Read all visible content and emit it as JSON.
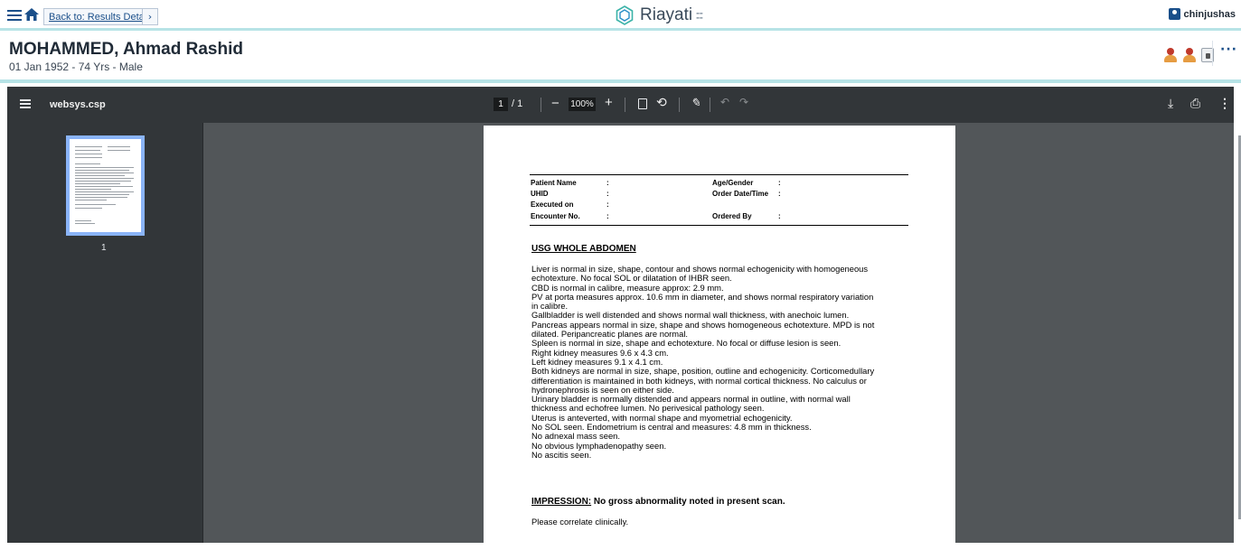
{
  "topbar": {
    "back_label": "Back to: Results Detail",
    "brand": "Riayati",
    "user": "chinjushas"
  },
  "patient": {
    "name": "MOHAMMED, Ahmad Rashid",
    "details": "01 Jan 1952 - 74 Yrs - Male"
  },
  "viewer": {
    "file_name": "websys.csp",
    "current_page": "1",
    "total_pages": "/ 1",
    "zoom": "100%",
    "thumbnail_label": "1"
  },
  "report": {
    "header_rows": [
      {
        "l1": "Patient Name",
        "l2": ":",
        "r1": "Age/Gender",
        "r2": ":"
      },
      {
        "l1": "UHID",
        "l2": ":",
        "r1": "Order Date/Time",
        "r2": ":"
      },
      {
        "l1": "Executed on",
        "l2": ":",
        "r1": "",
        "r2": ""
      },
      {
        "l1": "Encounter No.",
        "l2": ":",
        "r1": "Ordered By",
        "r2": ":"
      }
    ],
    "title": "USG WHOLE ABDOMEN",
    "lines": [
      "Liver is normal in size, shape, contour and shows normal echogenicity with homogeneous",
      "echotexture. No focal SOL or dilatation of IHBR seen.",
      "CBD is normal in calibre, measure approx: 2.9 mm.",
      "PV at porta measures approx. 10.6 mm in diameter, and shows normal respiratory variation",
      "in calibre.",
      "Gallbladder is well distended and shows normal wall thickness, with anechoic lumen.",
      "Pancreas appears normal in size, shape and shows homogeneous echotexture. MPD is not",
      "dilated. Peripancreatic planes are normal.",
      "Spleen is normal in size, shape and echotexture. No focal or diffuse lesion is seen.",
      "Right kidney measures 9.6 x 4.3 cm.",
      "Left kidney measures 9.1 x 4.1 cm.",
      "Both kidneys are normal in size, shape, position, outline and echogenicity. Corticomedullary",
      "differentiation is maintained in both kidneys, with normal cortical thickness. No calculus or",
      "hydronephrosis is seen on either side.",
      "Urinary bladder is normally distended and appears normal in outline, with normal wall",
      "thickness and echofree lumen. No perivesical pathology seen.",
      "Uterus is anteverted, with normal shape and myometrial echogenicity.",
      "No SOL seen. Endometrium is central and measures: 4.8 mm in thickness.",
      "No adnexal mass seen.",
      "No obvious lymphadenopathy seen.",
      "No ascitis seen."
    ],
    "impression_label": "IMPRESSION:",
    "impression_text": " No gross abnormality noted in present scan.",
    "closing": "Please correlate clinically."
  }
}
